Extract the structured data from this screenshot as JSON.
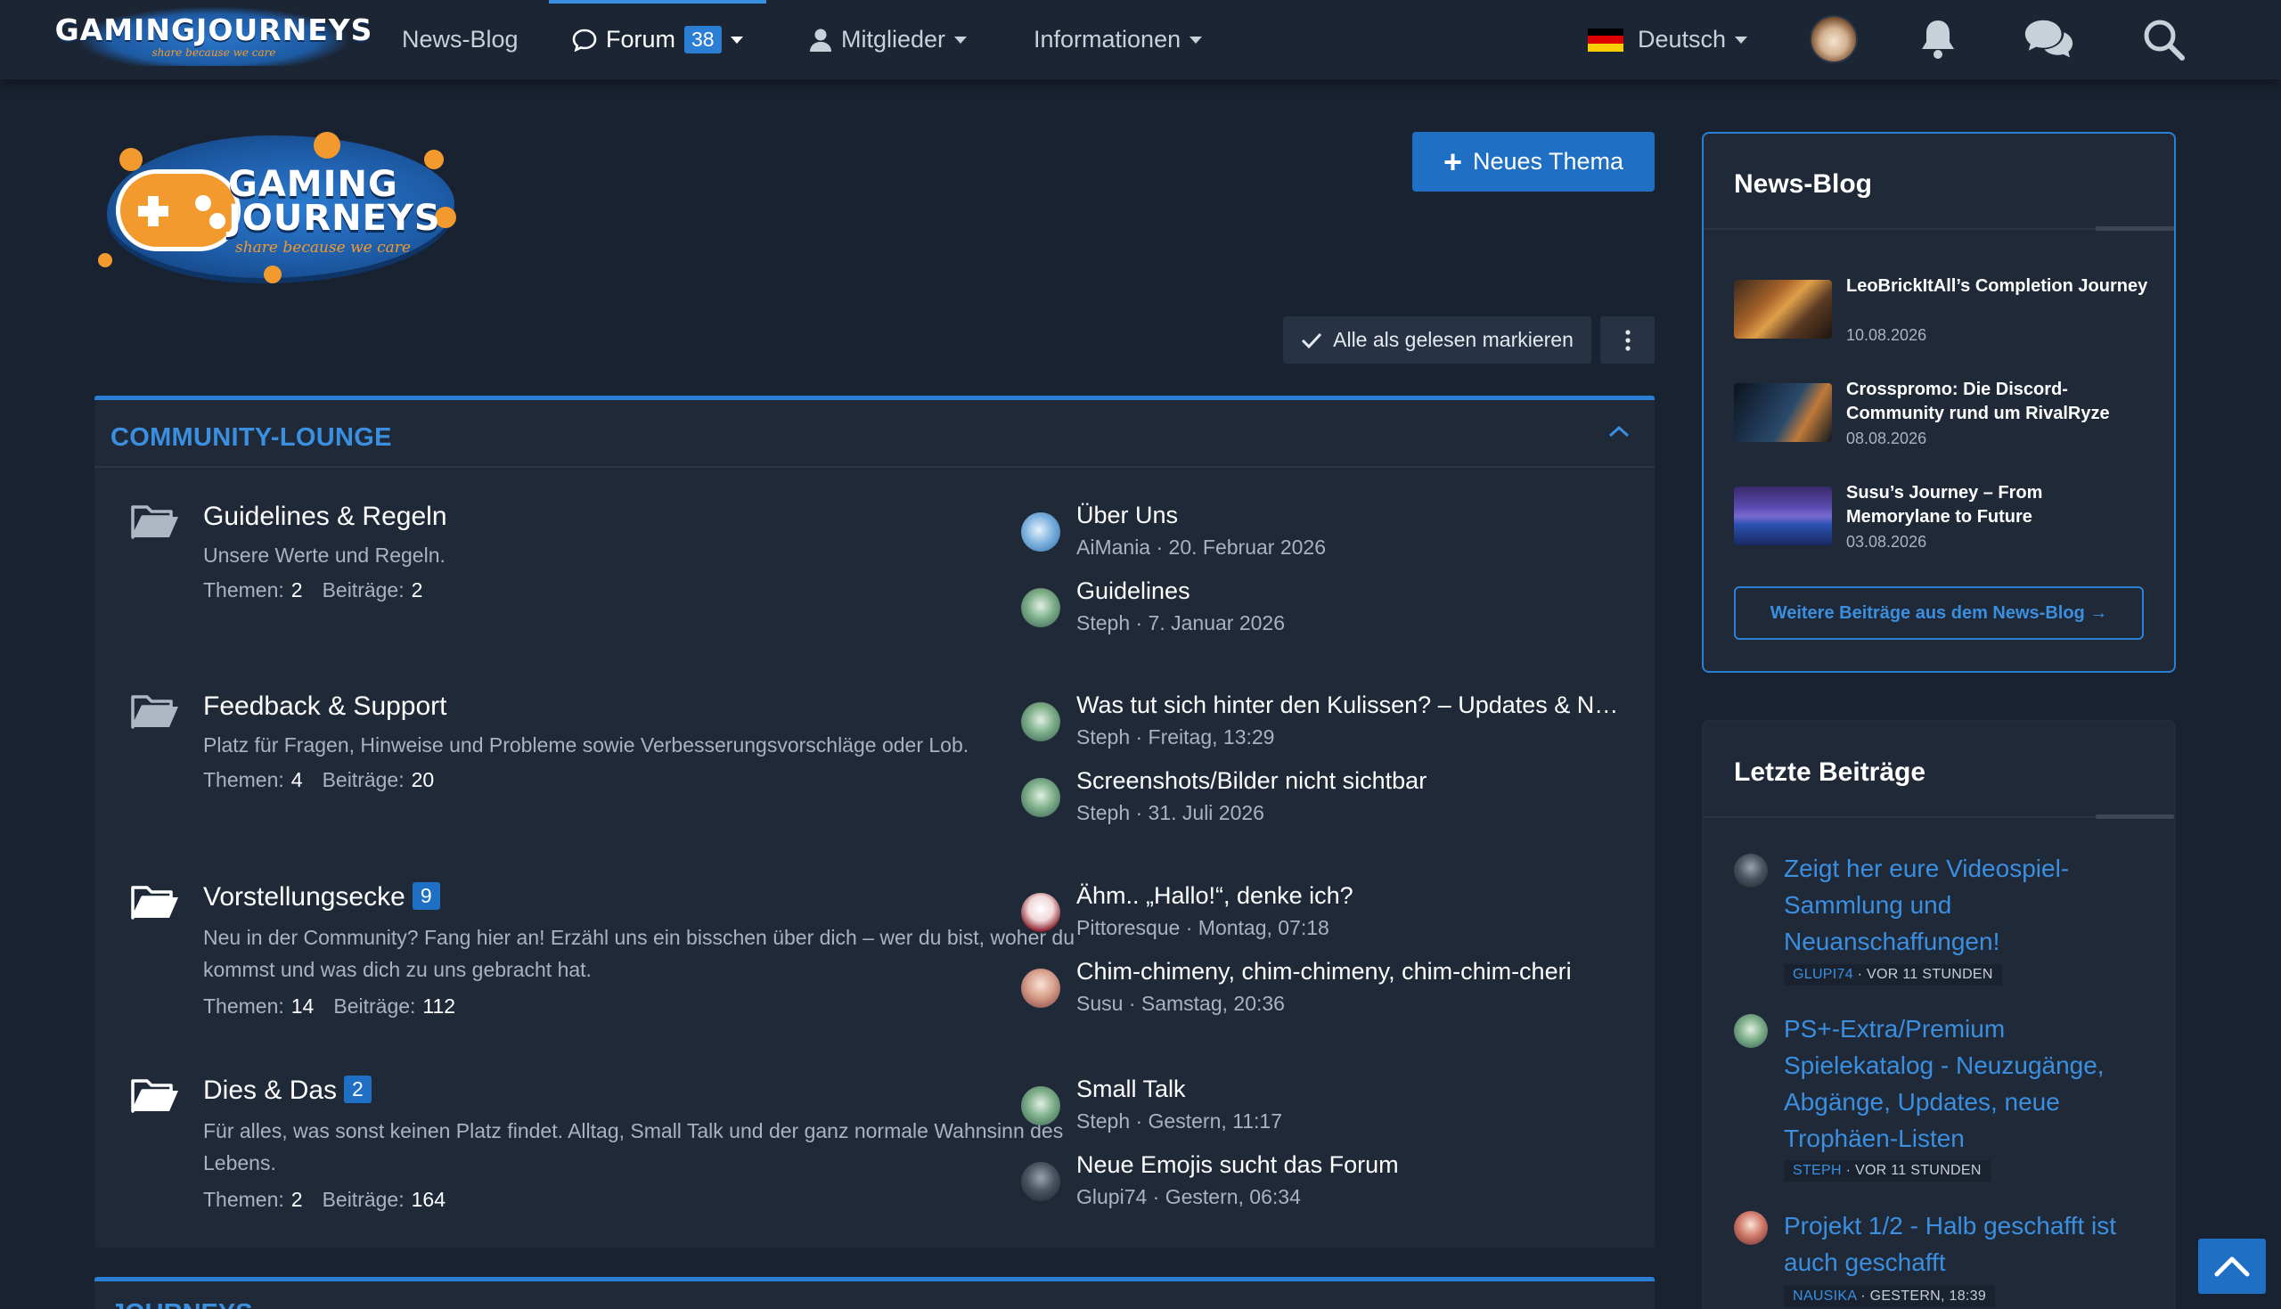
{
  "header": {
    "brand_name": "GAMINGJOURNEYS",
    "brand_tagline": "share because we care",
    "nav": [
      {
        "label": "News-Blog"
      },
      {
        "label": "Forum",
        "badge": "38"
      },
      {
        "label": "Mitglieder"
      },
      {
        "label": "Informationen"
      }
    ],
    "language": "Deutsch"
  },
  "logo": {
    "line1": "GAMING",
    "line2": "JOURNEYS",
    "tagline": "share because we care"
  },
  "actions": {
    "new_thread": "Neues Thema",
    "mark_read": "Alle als gelesen markieren"
  },
  "category": {
    "title": "COMMUNITY-LOUNGE",
    "nodes": [
      {
        "title": "Guidelines & Regeln",
        "badge": "",
        "description": "Unsere Werte und Regeln.",
        "stats": {
          "themes_label": "Themen:",
          "themes": "2",
          "posts_label": "Beiträge:",
          "posts": "2"
        },
        "threads": [
          {
            "title": "Über Uns",
            "meta": "AiMania · 20. Februar 2026"
          },
          {
            "title": "Guidelines",
            "meta": "Steph · 7. Januar 2026"
          }
        ]
      },
      {
        "title": "Feedback & Support",
        "badge": "",
        "description": "Platz für Fragen, Hinweise und Probleme sowie Verbesserungsvorschläge oder Lob.",
        "stats": {
          "themes_label": "Themen:",
          "themes": "4",
          "posts_label": "Beiträge:",
          "posts": "20"
        },
        "threads": [
          {
            "title": "Was tut sich hinter den Kulissen? – Updates & N…",
            "meta": "Steph · Freitag, 13:29"
          },
          {
            "title": "Screenshots/Bilder nicht sichtbar",
            "meta": "Steph · 31. Juli 2026"
          }
        ]
      },
      {
        "title": "Vorstellungsecke",
        "badge": "9",
        "description": "Neu in der Community? Fang hier an! Erzähl uns ein bisschen über dich – wer du bist, woher du kommst und was dich zu uns gebracht hat.",
        "stats": {
          "themes_label": "Themen:",
          "themes": "14",
          "posts_label": "Beiträge:",
          "posts": "112"
        },
        "threads": [
          {
            "title": "Ähm.. „Hallo!“, denke ich?",
            "meta": "Pittoresque · Montag, 07:18"
          },
          {
            "title": "Chim-chimeny, chim-chimeny, chim-chim-cheri",
            "meta": "Susu · Samstag, 20:36"
          }
        ]
      },
      {
        "title": "Dies & Das",
        "badge": "2",
        "description": "Für alles, was sonst keinen Platz findet. Alltag, Small Talk und der ganz normale Wahnsinn des Lebens.",
        "stats": {
          "themes_label": "Themen:",
          "themes": "2",
          "posts_label": "Beiträge:",
          "posts": "164"
        },
        "threads": [
          {
            "title": "Small Talk",
            "meta": "Steph · Gestern, 11:17"
          },
          {
            "title": "Neue Emojis sucht das Forum",
            "meta": "Glupi74 · Gestern, 06:34"
          }
        ]
      }
    ]
  },
  "next_category": {
    "title": "JOURNEYS"
  },
  "sidebar": {
    "blog": {
      "title": "News-Blog",
      "items": [
        {
          "title": "LeoBrickItAll’s Completion Journey",
          "date": "10.08.2026"
        },
        {
          "title": "Crosspromo: Die Discord-Community rund um RivalRyze",
          "date": "08.08.2026"
        },
        {
          "title": "Susu’s Journey – From Memorylane to Future",
          "date": "03.08.2026"
        }
      ],
      "more": "Weitere Beiträge aus dem News-Blog →"
    },
    "posts": {
      "title": "Letzte Beiträge",
      "items": [
        {
          "title": "Zeigt her eure Videospiel-Sammlung und Neuanschaffungen!",
          "user": "GLUPI74",
          "time": "· VOR 11 STUNDEN"
        },
        {
          "title": "PS+-Extra/Premium Spielekatalog - Neuzugänge, Abgänge, Updates, neue Trophäen-Listen",
          "user": "STEPH",
          "time": "· VOR 11 STUNDEN"
        },
        {
          "title": "Projekt 1/2 - Halb geschafft ist auch geschafft",
          "user": "NAUSIKA",
          "time": "· GESTERN, 18:39"
        }
      ]
    }
  },
  "colors": {
    "background": "#192230",
    "panel": "#1f2938",
    "accent": "#2a7fd4",
    "link": "#3b8fe0",
    "brand_orange": "#f39a2e"
  },
  "icons": [
    "chat-bubble-icon",
    "user-icon",
    "flag-de-icon",
    "bell-icon",
    "conversations-icon",
    "search-icon",
    "check-icon",
    "more-vertical-icon",
    "chevron-up-icon",
    "folder-icon",
    "plus-icon",
    "arrow-up-icon"
  ]
}
